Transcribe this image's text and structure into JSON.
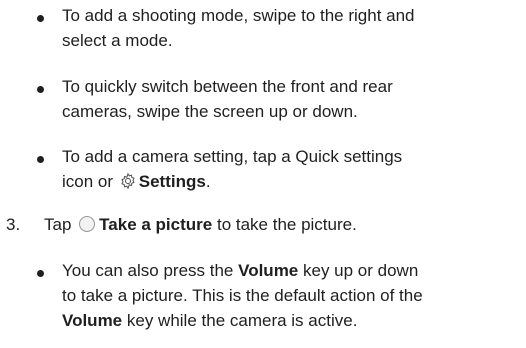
{
  "bullets_top": [
    {
      "line1": "To add a shooting mode, swipe to the right and",
      "line2": "select a mode."
    },
    {
      "line1": "To quickly switch between the front and rear",
      "line2": "cameras, swipe the screen up or down."
    },
    {
      "line1": "To add a camera setting, tap a Quick settings",
      "line2_prefix": "icon or",
      "line2_bold": "Settings",
      "line2_suffix": ".",
      "icon": "settings-gear-icon"
    }
  ],
  "step3": {
    "number": "3.",
    "prefix": "Tap",
    "icon": "shutter-circle-icon",
    "bold": "Take a picture",
    "suffix": "to take the picture."
  },
  "sub_bullet": {
    "l1_prefix": "You can also press the",
    "l1_bold": "Volume",
    "l1_suffix": "key up or down",
    "l2": "to take a picture. This is the default action of the",
    "l3_bold": "Volume",
    "l3_suffix": "key while the camera is active."
  }
}
